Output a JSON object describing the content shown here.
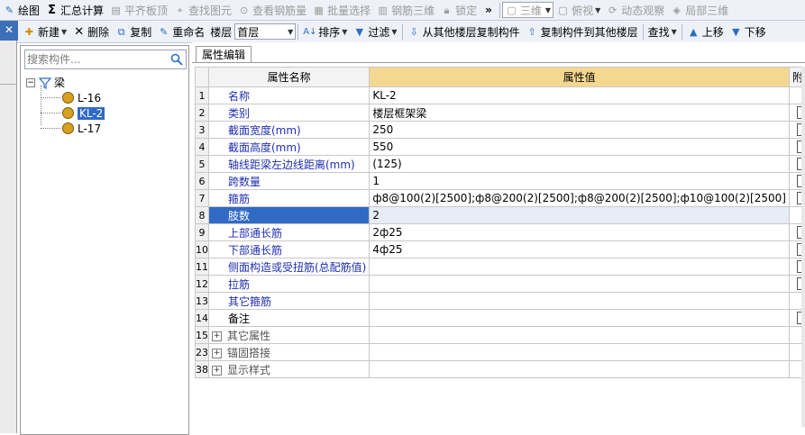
{
  "toolbar1": {
    "draw": "绘图",
    "summary": "汇总计算",
    "flat_slab": "平齐板顶",
    "find_element": "查找图元",
    "view_rebar": "查看钢筋量",
    "batch_select": "批量选择",
    "rebar_3d": "钢筋三维",
    "lock": "锁定",
    "overflow": "»",
    "view_mode": "三维",
    "top_view": "俯视",
    "dynamic_view": "动态观察",
    "partial_3d": "局部三维"
  },
  "toolbar2": {
    "close": "✕",
    "new": "新建",
    "delete": "删除",
    "copy": "复制",
    "rename": "重命名",
    "floor_label": "楼层",
    "floor_value": "首层",
    "sort": "排序",
    "filter": "过滤",
    "copy_from_other_floor": "从其他楼层复制构件",
    "copy_to_other_floor": "复制构件到其他楼层",
    "find": "查找",
    "move_up": "上移",
    "move_down": "下移"
  },
  "tree": {
    "search_placeholder": "搜索构件...",
    "root": "梁",
    "items": [
      "L-16",
      "KL-2",
      "L-17"
    ],
    "selected": "KL-2"
  },
  "tab": "属性编辑",
  "table": {
    "headers": [
      "属性名称",
      "属性值",
      "附加"
    ],
    "rows": [
      {
        "n": "1",
        "name": "名称",
        "value": "KL-2",
        "chk": false
      },
      {
        "n": "2",
        "name": "类别",
        "value": "楼层框架梁",
        "chk": true
      },
      {
        "n": "3",
        "name": "截面宽度(mm)",
        "value": "250",
        "chk": true
      },
      {
        "n": "4",
        "name": "截面高度(mm)",
        "value": "550",
        "chk": true
      },
      {
        "n": "5",
        "name": "轴线距梁左边线距离(mm)",
        "value": "(125)",
        "chk": true
      },
      {
        "n": "6",
        "name": "跨数量",
        "value": "1",
        "chk": true
      },
      {
        "n": "7",
        "name": "箍筋",
        "value": "ф8@100(2)[2500];ф8@200(2)[2500];ф8@200(2)[2500];ф10@100(2)[2500]",
        "chk": true
      },
      {
        "n": "8",
        "name": "肢数",
        "value": "2",
        "chk": false
      },
      {
        "n": "9",
        "name": "上部通长筋",
        "value": "2ф25",
        "chk": true
      },
      {
        "n": "10",
        "name": "下部通长筋",
        "value": "4ф25",
        "chk": true
      },
      {
        "n": "11",
        "name": "侧面构造或受扭筋(总配筋值)",
        "value": "",
        "chk": true
      },
      {
        "n": "12",
        "name": "拉筋",
        "value": "",
        "chk": true
      },
      {
        "n": "13",
        "name": "其它箍筋",
        "value": "",
        "chk": false
      },
      {
        "n": "14",
        "name": "备注",
        "value": "",
        "chk": true
      },
      {
        "n": "15",
        "name": "其它属性",
        "value": "",
        "chk": false
      },
      {
        "n": "23",
        "name": "锚固搭接",
        "value": "",
        "chk": false
      },
      {
        "n": "38",
        "name": "显示样式",
        "value": "",
        "chk": false
      }
    ]
  }
}
